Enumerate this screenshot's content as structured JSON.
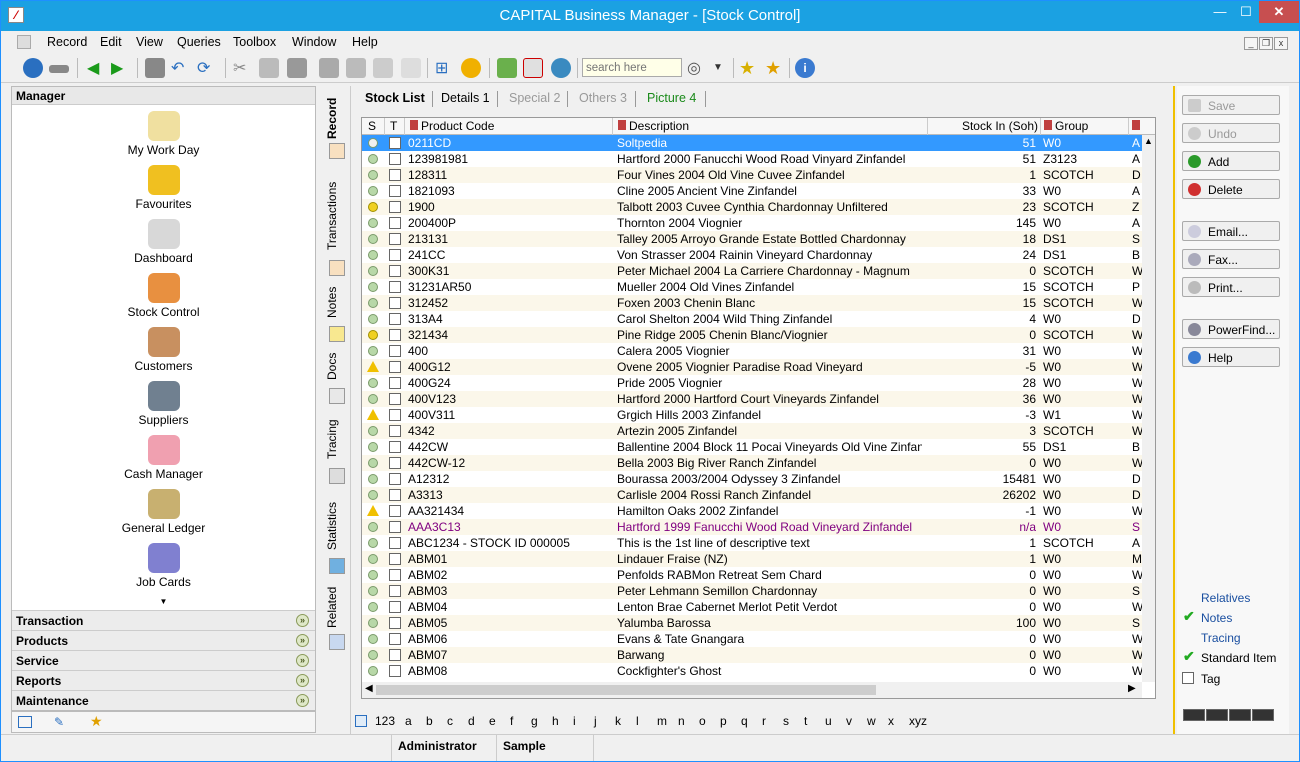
{
  "window": {
    "title": "CAPITAL Business Manager - [Stock Control]",
    "minimize": "—",
    "maximize": "☐",
    "close": "✕"
  },
  "menu": [
    "Record",
    "Edit",
    "View",
    "Queries",
    "Toolbox",
    "Window",
    "Help"
  ],
  "search": {
    "placeholder": "search here"
  },
  "manager": {
    "title": "Manager",
    "items": [
      "My Work Day",
      "Favourites",
      "Dashboard",
      "Stock Control",
      "Customers",
      "Suppliers",
      "Cash Manager",
      "General Ledger",
      "Job Cards"
    ],
    "sections": [
      "Transaction",
      "Products",
      "Service",
      "Reports",
      "Maintenance"
    ]
  },
  "vtabs": [
    "Record",
    "Transactions",
    "Notes",
    "Docs",
    "Tracing",
    "Statistics",
    "Related"
  ],
  "tabs": [
    {
      "label": "Stock List",
      "state": "active"
    },
    {
      "label": "Details 1",
      "state": "normal"
    },
    {
      "label": "Special 2",
      "state": "disabled"
    },
    {
      "label": "Others 3",
      "state": "disabled"
    },
    {
      "label": "Picture 4",
      "state": "green"
    }
  ],
  "grid": {
    "headers": [
      "S",
      "T",
      "Product Code",
      "Description",
      "Stock In (Soh)",
      "Group"
    ],
    "rows": [
      {
        "s": "gear",
        "code": "0211CD",
        "desc": "Soltpedia",
        "stock": "51",
        "group": "W0",
        "extra": "A"
      },
      {
        "s": "g",
        "code": "123981981",
        "desc": "Hartford 2000 Fanucchi Wood Road Vinyard Zinfandel",
        "stock": "51",
        "group": "Z3123",
        "extra": "A"
      },
      {
        "s": "g",
        "code": "128311",
        "desc": "Four Vines 2004 Old Vine Cuvee Zinfandel",
        "stock": "1",
        "group": "SCOTCH",
        "extra": "D"
      },
      {
        "s": "g",
        "code": "1821093",
        "desc": "Cline 2005 Ancient Vine Zinfandel",
        "stock": "33",
        "group": "W0",
        "extra": "A"
      },
      {
        "s": "y",
        "code": "1900",
        "desc": "Talbott 2003 Cuvee Cynthia Chardonnay Unfiltered",
        "stock": "23",
        "group": "SCOTCH",
        "extra": "Z"
      },
      {
        "s": "g",
        "code": "200400P",
        "desc": "Thornton 2004 Viognier",
        "stock": "145",
        "group": "W0",
        "extra": "A"
      },
      {
        "s": "g",
        "code": "213131",
        "desc": "Talley 2005 Arroyo Grande Estate Bottled Chardonnay",
        "stock": "18",
        "group": "DS1",
        "extra": "S"
      },
      {
        "s": "g",
        "code": "241CC",
        "desc": "Von Strasser 2004 Rainin Vineyard Chardonnay",
        "stock": "24",
        "group": "DS1",
        "extra": "B"
      },
      {
        "s": "g",
        "code": "300K31",
        "desc": "Peter Michael 2004 La Carriere Chardonnay - Magnum",
        "stock": "0",
        "group": "SCOTCH",
        "extra": "W"
      },
      {
        "s": "g",
        "code": "31231AR50",
        "desc": "Mueller 2004 Old Vines Zinfandel",
        "stock": "15",
        "group": "SCOTCH",
        "extra": "P"
      },
      {
        "s": "g",
        "code": "312452",
        "desc": "Foxen 2003 Chenin Blanc",
        "stock": "15",
        "group": "SCOTCH",
        "extra": "W"
      },
      {
        "s": "g",
        "code": "313A4",
        "desc": "Carol Shelton 2004 Wild Thing Zinfandel",
        "stock": "4",
        "group": "W0",
        "extra": "D"
      },
      {
        "s": "y",
        "code": "321434",
        "desc": "Pine Ridge 2005 Chenin Blanc/Viognier",
        "stock": "0",
        "group": "SCOTCH",
        "extra": "W"
      },
      {
        "s": "g",
        "code": "400",
        "desc": "Calera 2005 Viognier",
        "stock": "31",
        "group": "W0",
        "extra": "W"
      },
      {
        "s": "w",
        "code": "400G12",
        "desc": "Ovene 2005 Viognier Paradise Road Vineyard",
        "stock": "-5",
        "group": "W0",
        "extra": "W"
      },
      {
        "s": "g",
        "code": "400G24",
        "desc": "Pride 2005 Viognier",
        "stock": "28",
        "group": "W0",
        "extra": "W"
      },
      {
        "s": "g",
        "code": "400V123",
        "desc": "Hartford 2000 Hartford Court Vineyards Zinfandel",
        "stock": "36",
        "group": "W0",
        "extra": "W"
      },
      {
        "s": "w",
        "code": "400V311",
        "desc": "Grgich Hills 2003 Zinfandel",
        "stock": "-3",
        "group": "W1",
        "extra": "W"
      },
      {
        "s": "g",
        "code": "4342",
        "desc": "Artezin 2005 Zinfandel",
        "stock": "3",
        "group": "SCOTCH",
        "extra": "W"
      },
      {
        "s": "g",
        "code": "442CW",
        "desc": "Ballentine 2004 Block 11 Pocai Vineyards Old Vine Zinfandel",
        "stock": "55",
        "group": "DS1",
        "extra": "B"
      },
      {
        "s": "g",
        "code": "442CW-12",
        "desc": "Bella 2003 Big River Ranch Zinfandel",
        "stock": "0",
        "group": "W0",
        "extra": "W"
      },
      {
        "s": "g",
        "code": "A12312",
        "desc": "Bourassa 2003/2004 Odyssey 3 Zinfandel",
        "stock": "15481",
        "group": "W0",
        "extra": "D"
      },
      {
        "s": "g",
        "code": "A3313",
        "desc": "Carlisle 2004 Rossi Ranch Zinfandel",
        "stock": "26202",
        "group": "W0",
        "extra": "D"
      },
      {
        "s": "w",
        "code": "AA321434",
        "desc": "Hamilton Oaks 2002 Zinfandel",
        "stock": "-1",
        "group": "W0",
        "extra": "W"
      },
      {
        "s": "g",
        "code": "AAA3C13",
        "desc": "Hartford 1999 Fanucchi Wood Road Vineyard Zinfandel",
        "stock": "n/a",
        "group": "W0",
        "extra": "S",
        "purple": true
      },
      {
        "s": "g",
        "code": "ABC1234 - STOCK ID 000005",
        "desc": "This is the 1st line of descriptive text",
        "stock": "1",
        "group": "SCOTCH",
        "extra": "A"
      },
      {
        "s": "g",
        "code": "ABM01",
        "desc": "Lindauer Fraise (NZ)",
        "stock": "1",
        "group": "W0",
        "extra": "M"
      },
      {
        "s": "g",
        "code": "ABM02",
        "desc": "Penfolds RABMon Retreat Sem Chard",
        "stock": "0",
        "group": "W0",
        "extra": "W"
      },
      {
        "s": "g",
        "code": "ABM03",
        "desc": "Peter Lehmann Semillon Chardonnay",
        "stock": "0",
        "group": "W0",
        "extra": "S"
      },
      {
        "s": "g",
        "code": "ABM04",
        "desc": "Lenton Brae Cabernet Merlot Petit Verdot",
        "stock": "0",
        "group": "W0",
        "extra": "W"
      },
      {
        "s": "g",
        "code": "ABM05",
        "desc": "Yalumba Barossa",
        "stock": "100",
        "group": "W0",
        "extra": "S"
      },
      {
        "s": "g",
        "code": "ABM06",
        "desc": "Evans & Tate Gnangara",
        "stock": "0",
        "group": "W0",
        "extra": "W"
      },
      {
        "s": "g",
        "code": "ABM07",
        "desc": "Barwang",
        "stock": "0",
        "group": "W0",
        "extra": "W"
      },
      {
        "s": "g",
        "code": "ABM08",
        "desc": "Cockfighter's Ghost",
        "stock": "0",
        "group": "W0",
        "extra": "W"
      }
    ]
  },
  "alphabet": [
    "123",
    "a",
    "b",
    "c",
    "d",
    "e",
    "f",
    "g",
    "h",
    "i",
    "j",
    "k",
    "l",
    "m",
    "n",
    "o",
    "p",
    "q",
    "r",
    "s",
    "t",
    "u",
    "v",
    "w",
    "x",
    "xyz"
  ],
  "actions": {
    "buttons": [
      {
        "label": "Save",
        "disabled": true
      },
      {
        "label": "Undo",
        "disabled": true
      },
      {
        "label": "Add",
        "disabled": false
      },
      {
        "label": "Delete",
        "disabled": false
      },
      {
        "label": "Email...",
        "disabled": false
      },
      {
        "label": "Fax...",
        "disabled": false
      },
      {
        "label": "Print...",
        "disabled": false
      },
      {
        "label": "PowerFind...",
        "disabled": false
      },
      {
        "label": "Help",
        "disabled": false
      }
    ],
    "links": [
      "Relatives",
      "Notes",
      "Tracing",
      "Standard Item"
    ],
    "tag_label": "Tag"
  },
  "status": {
    "user": "Administrator",
    "company": "Sample"
  },
  "colors": {
    "titlebar": "#1ba1e2",
    "selection": "#3399ff",
    "accent": "#f0c000"
  }
}
